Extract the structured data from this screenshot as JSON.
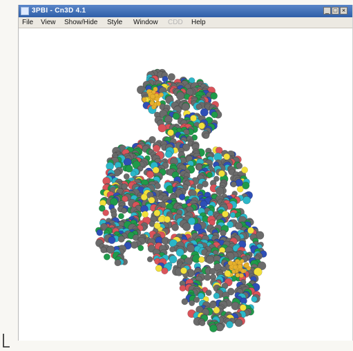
{
  "window": {
    "title": "3PBI - Cn3D 4.1",
    "minimize_glyph": "_",
    "maximize_glyph": "□",
    "close_glyph": "×"
  },
  "menu": {
    "items": [
      {
        "label": "File",
        "enabled": true
      },
      {
        "label": "View",
        "enabled": true
      },
      {
        "label": "Show/Hide",
        "enabled": true
      },
      {
        "label": "Style",
        "enabled": true
      },
      {
        "label": "Window",
        "enabled": true
      },
      {
        "label": "CDD",
        "enabled": false
      },
      {
        "label": "Help",
        "enabled": true
      }
    ]
  },
  "viewer": {
    "content": "space-filling protein structure model",
    "colors": {
      "background": "#ffffff",
      "carbon": "#6b6b6b",
      "helix": "#1f9a4a",
      "strand": "#2bb7c9",
      "nitrogen": "#2e4fb7",
      "oxygen": "#d9535a",
      "sulfur": "#f2e03a",
      "ligand": "#e6b12e"
    }
  },
  "icons": {
    "app": "cn3d-app-icon",
    "cursor": "text-cursor-icon"
  }
}
